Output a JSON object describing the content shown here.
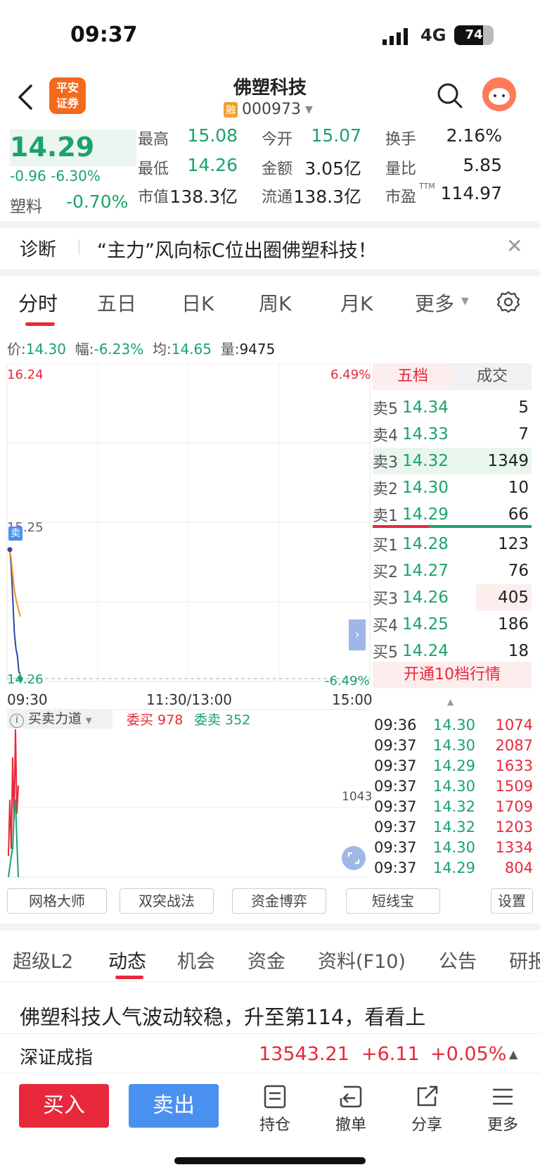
{
  "status_bar": {
    "time": "09:37",
    "network": "4G",
    "battery": "74",
    "battery_level": 0.74
  },
  "header": {
    "broker_logo": "平安\n证券",
    "title": "佛塑科技",
    "rong_badge": "融",
    "code": "000973"
  },
  "quote": {
    "price": "14.29",
    "change": "-0.96",
    "change_pct": "-6.30%",
    "sector_label": "塑料",
    "sector_pct": "-0.70%",
    "stats": [
      {
        "label": "最高",
        "value": "15.08",
        "color": "green"
      },
      {
        "label": "今开",
        "value": "15.07",
        "color": "green"
      },
      {
        "label": "换手",
        "value": "2.16%",
        "color": "black"
      },
      {
        "label": "最低",
        "value": "14.26",
        "color": "green"
      },
      {
        "label": "金额",
        "value": "3.05亿",
        "color": "black"
      },
      {
        "label": "量比",
        "value": "5.85",
        "color": "black"
      },
      {
        "label": "市值",
        "value": "138.3亿",
        "color": "black"
      },
      {
        "label": "流通",
        "value": "138.3亿",
        "color": "black"
      },
      {
        "label": "市盈",
        "value": "114.97",
        "color": "black",
        "sup": "TTM"
      }
    ]
  },
  "diagnosis": {
    "label": "诊断",
    "text": "“主力”风向标C位出圈佛塑科技！"
  },
  "chart_tabs": [
    "分时",
    "五日",
    "日K",
    "周K",
    "月K",
    "更多"
  ],
  "price_bar": {
    "price_label": "价:",
    "price": "14.30",
    "amp_label": "幅:",
    "amp": "-6.23%",
    "avg_label": "均:",
    "avg": "14.65",
    "vol_label": "量:",
    "vol": "9475"
  },
  "chart_labels": {
    "top_price": "16.24",
    "top_pct": "6.49%",
    "mid_price": "15.25",
    "bottom_price": "14.26",
    "bottom_pct": "-6.49%",
    "t_start": "09:30",
    "t_mid": "11:30/13:00",
    "t_end": "15:00",
    "sell_marker": "卖"
  },
  "chart_data": {
    "type": "line",
    "x": [
      "09:30",
      "09:31",
      "09:32",
      "09:33",
      "09:34",
      "09:35",
      "09:36",
      "09:37"
    ],
    "series": [
      {
        "values": [
          15.07,
          14.95,
          14.75,
          14.55,
          14.45,
          14.4,
          14.3,
          14.29
        ],
        "color": "#2a4aa0"
      },
      {
        "values": [
          15.07,
          15.0,
          14.9,
          14.82,
          14.76,
          14.72,
          14.68,
          14.65
        ],
        "color": "#f39020"
      }
    ],
    "ylim": [
      14.26,
      16.24
    ]
  },
  "strength": {
    "label": "买卖力道",
    "wei_buy": "委买 978",
    "wei_sell": "委卖 352",
    "level": "1043"
  },
  "order_book": {
    "tabs": [
      "五档",
      "成交"
    ],
    "asks": [
      {
        "label": "卖5",
        "price": "14.34",
        "vol": "5"
      },
      {
        "label": "卖4",
        "price": "14.33",
        "vol": "7"
      },
      {
        "label": "卖3",
        "price": "14.32",
        "vol": "1349"
      },
      {
        "label": "卖2",
        "price": "14.30",
        "vol": "10"
      },
      {
        "label": "卖1",
        "price": "14.29",
        "vol": "66"
      }
    ],
    "bids": [
      {
        "label": "买1",
        "price": "14.28",
        "vol": "123"
      },
      {
        "label": "买2",
        "price": "14.27",
        "vol": "76"
      },
      {
        "label": "买3",
        "price": "14.26",
        "vol": "405"
      },
      {
        "label": "买4",
        "price": "14.25",
        "vol": "186"
      },
      {
        "label": "买5",
        "price": "14.24",
        "vol": "18"
      }
    ],
    "upgrade": "开通10档行情"
  },
  "trades": [
    {
      "time": "09:36",
      "price": "14.30",
      "vol": "1074"
    },
    {
      "time": "09:37",
      "price": "14.30",
      "vol": "2087"
    },
    {
      "time": "09:37",
      "price": "14.29",
      "vol": "1633"
    },
    {
      "time": "09:37",
      "price": "14.30",
      "vol": "1509"
    },
    {
      "time": "09:37",
      "price": "14.32",
      "vol": "1709"
    },
    {
      "time": "09:37",
      "price": "14.32",
      "vol": "1203"
    },
    {
      "time": "09:37",
      "price": "14.30",
      "vol": "1334"
    },
    {
      "time": "09:37",
      "price": "14.29",
      "vol": "804"
    }
  ],
  "tools": [
    "网格大师",
    "双突战法",
    "资金博弈",
    "短线宝",
    "设置"
  ],
  "bottom_tabs": [
    "超级L2",
    "动态",
    "机会",
    "资金",
    "资料(F10)",
    "公告",
    "研报"
  ],
  "news": "佛塑科技人气波动较稳，升至第114，看看上",
  "index": {
    "name": "深证成指",
    "value": "13543.21",
    "change": "+6.11",
    "pct": "+0.05%"
  },
  "actions": {
    "buy": "买入",
    "sell": "卖出",
    "items": [
      "持仓",
      "撤单",
      "分享",
      "更多"
    ]
  },
  "colors": {
    "red": "#e8283b",
    "green": "#1aa36a",
    "blue": "#4a90f0"
  }
}
